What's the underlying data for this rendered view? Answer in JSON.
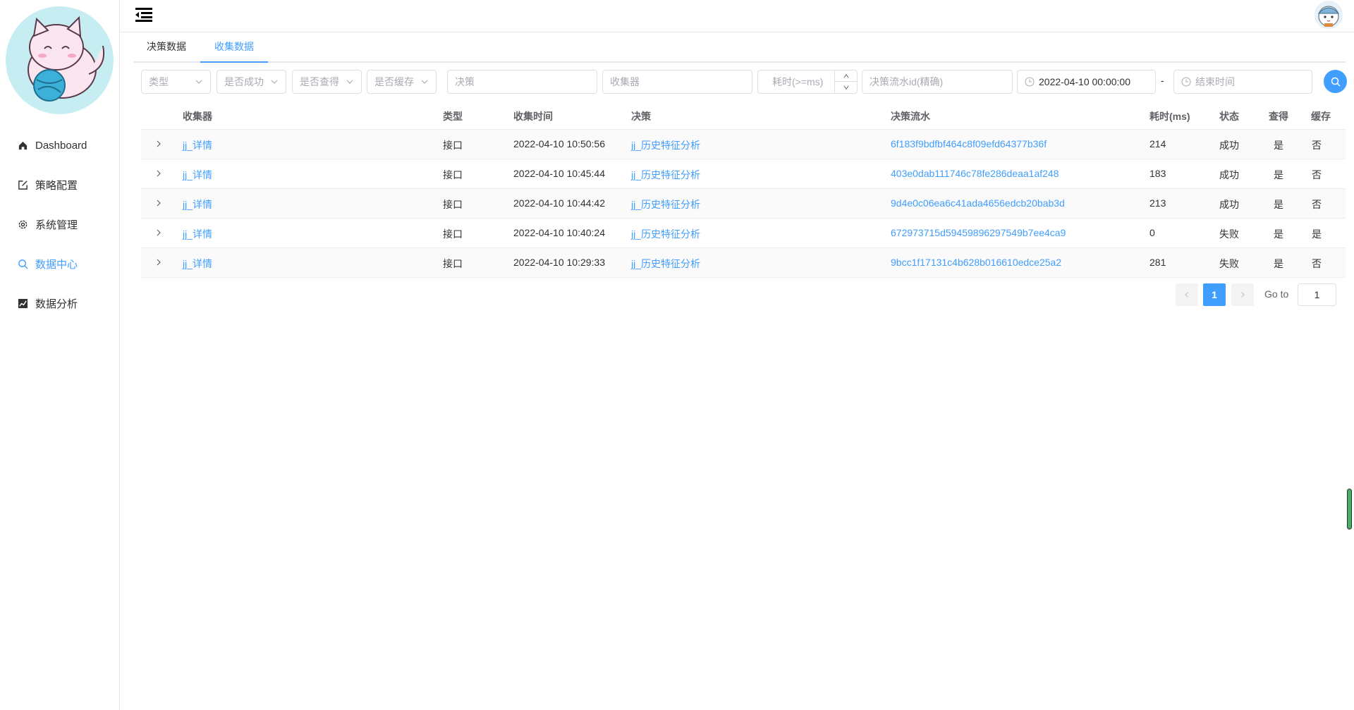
{
  "sidebar": {
    "items": [
      {
        "label": "Dashboard",
        "icon": "home-icon",
        "active": false
      },
      {
        "label": "策略配置",
        "icon": "edit-icon",
        "active": false
      },
      {
        "label": "系统管理",
        "icon": "gear-icon",
        "active": false
      },
      {
        "label": "数据中心",
        "icon": "search-icon",
        "active": true
      },
      {
        "label": "数据分析",
        "icon": "chart-icon",
        "active": false
      }
    ]
  },
  "tabs": [
    {
      "label": "决策数据",
      "active": false
    },
    {
      "label": "收集数据",
      "active": true
    }
  ],
  "filters": {
    "type_placeholder": "类型",
    "success_placeholder": "是否成功",
    "found_placeholder": "是否查得",
    "cache_placeholder": "是否缓存",
    "decision_placeholder": "决策",
    "collector_placeholder": "收集器",
    "duration_placeholder": "耗时(>=ms)",
    "flow_id_placeholder": "决策流水id(精确)",
    "start_time_value": "2022-04-10 00:00:00",
    "separator": "-",
    "end_time_placeholder": "结束时间"
  },
  "table": {
    "headers": {
      "collector": "收集器",
      "type": "类型",
      "collect_time": "收集时间",
      "decision": "决策",
      "flow": "决策流水",
      "duration": "耗时(ms)",
      "status": "状态",
      "found": "查得",
      "cache": "缓存"
    },
    "rows": [
      {
        "collector": "jj_详情",
        "type": "接口",
        "collect_time": "2022-04-10 10:50:56",
        "decision": "jj_历史特征分析",
        "flow": "6f183f9bdfbf464c8f09efd64377b36f",
        "duration": "214",
        "status": "成功",
        "found": "是",
        "cache": "否"
      },
      {
        "collector": "jj_详情",
        "type": "接口",
        "collect_time": "2022-04-10 10:45:44",
        "decision": "jj_历史特征分析",
        "flow": "403e0dab111746c78fe286deaa1af248",
        "duration": "183",
        "status": "成功",
        "found": "是",
        "cache": "否"
      },
      {
        "collector": "jj_详情",
        "type": "接口",
        "collect_time": "2022-04-10 10:44:42",
        "decision": "jj_历史特征分析",
        "flow": "9d4e0c06ea6c41ada4656edcb20bab3d",
        "duration": "213",
        "status": "成功",
        "found": "是",
        "cache": "否"
      },
      {
        "collector": "jj_详情",
        "type": "接口",
        "collect_time": "2022-04-10 10:40:24",
        "decision": "jj_历史特征分析",
        "flow": "672973715d59459896297549b7ee4ca9",
        "duration": "0",
        "status": "失败",
        "found": "是",
        "cache": "是"
      },
      {
        "collector": "jj_详情",
        "type": "接口",
        "collect_time": "2022-04-10 10:29:33",
        "decision": "jj_历史特征分析",
        "flow": "9bcc1f17131c4b628b016610edce25a2",
        "duration": "281",
        "status": "失败",
        "found": "是",
        "cache": "否"
      }
    ]
  },
  "pagination": {
    "current_page": "1",
    "goto_label": "Go to",
    "goto_value": "1"
  },
  "colors": {
    "accent": "#409eff",
    "border": "#dcdfe6"
  }
}
